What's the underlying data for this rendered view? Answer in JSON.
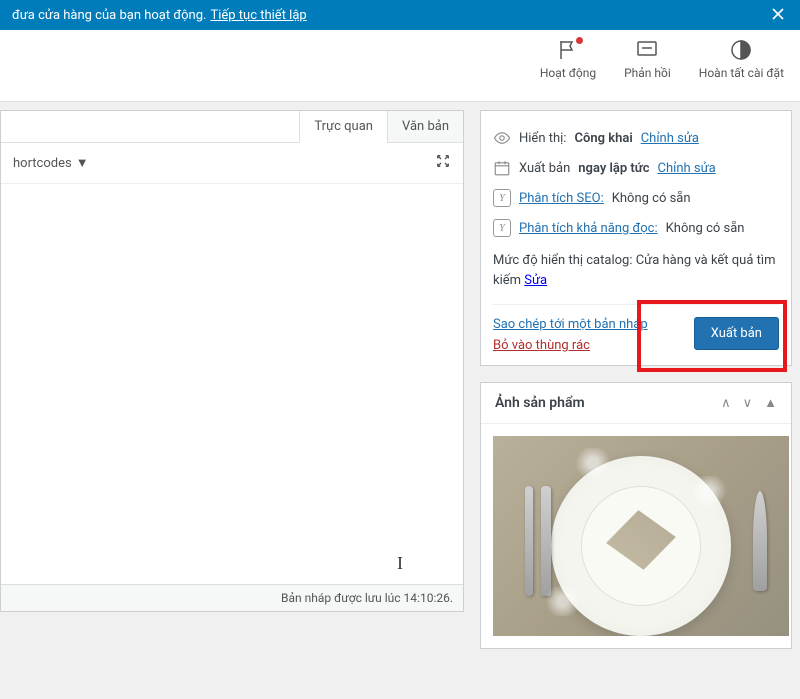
{
  "banner": {
    "text": "đưa cửa hàng của bạn hoạt động.",
    "link": "Tiếp tục thiết lập"
  },
  "topbar": {
    "activity": "Hoạt động",
    "feedback": "Phản hồi",
    "finish": "Hoàn tất cài đặt"
  },
  "editor": {
    "tab_visual": "Trực quan",
    "tab_text": "Văn bản",
    "shortcodes": "hortcodes",
    "status": "Bản nháp được lưu lúc 14:10:26."
  },
  "publish": {
    "visibility_label": "Hiển thị:",
    "visibility_value": "Công khai",
    "visibility_edit": "Chỉnh sửa",
    "schedule_label": "Xuất bản",
    "schedule_value": "ngay lập tức",
    "schedule_edit": "Chỉnh sửa",
    "seo_label": "Phân tích SEO",
    "seo_value": "Không có sẵn",
    "read_label": "Phân tích khả năng đọc",
    "read_value": "Không có sẵn",
    "catalog_label": "Mức độ hiển thị catalog:",
    "catalog_value": "Cửa hàng và kết quả tìm kiếm",
    "catalog_edit": "Sửa",
    "copy_draft": "Sao chép tới một bản nháp",
    "trash": "Bỏ vào thùng rác",
    "publish_btn": "Xuất bản"
  },
  "image_box": {
    "title": "Ảnh sản phẩm"
  }
}
